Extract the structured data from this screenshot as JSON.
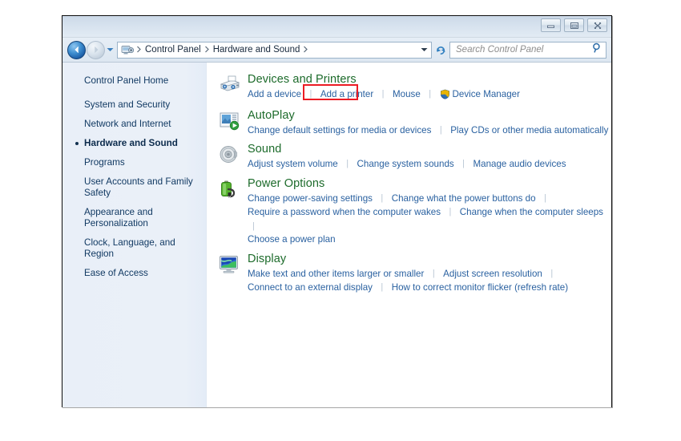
{
  "window": {
    "controls": [
      {
        "name": "minimize-button",
        "glyph": "minimize"
      },
      {
        "name": "restore-button",
        "glyph": "restore"
      },
      {
        "name": "close-button",
        "glyph": "close"
      }
    ]
  },
  "addressbar": {
    "back_label": "Back",
    "forward_label": "Forward",
    "history_label": "Recent pages",
    "crumb_icon": "control-panel-icon",
    "breadcrumbs": [
      "Control Panel",
      "Hardware and Sound"
    ],
    "refresh_label": "Refresh",
    "dropdown_label": "Previous locations"
  },
  "search": {
    "placeholder": "Search Control Panel",
    "icon": "search-icon"
  },
  "sidebar": {
    "home": "Control Panel Home",
    "items": [
      {
        "label": "System and Security",
        "active": false
      },
      {
        "label": "Network and Internet",
        "active": false
      },
      {
        "label": "Hardware and Sound",
        "active": true
      },
      {
        "label": "Programs",
        "active": false
      },
      {
        "label": "User Accounts and Family Safety",
        "active": false
      },
      {
        "label": "Appearance and Personalization",
        "active": false
      },
      {
        "label": "Clock, Language, and Region",
        "active": false
      },
      {
        "label": "Ease of Access",
        "active": false
      }
    ]
  },
  "categories": [
    {
      "title": "Devices and Printers",
      "icon": "devices-and-printers-icon",
      "rows": [
        [
          {
            "label": "Add a device"
          },
          {
            "label": "Add a printer",
            "highlighted": true
          },
          {
            "label": "Mouse"
          },
          {
            "label": "Device Manager",
            "shield": true,
            "no_sep_after_prev": false
          }
        ]
      ]
    },
    {
      "title": "AutoPlay",
      "icon": "autoplay-icon",
      "rows": [
        [
          {
            "label": "Change default settings for media or devices"
          },
          {
            "label": "Play CDs or other media automatically"
          }
        ]
      ]
    },
    {
      "title": "Sound",
      "icon": "sound-icon",
      "rows": [
        [
          {
            "label": "Adjust system volume"
          },
          {
            "label": "Change system sounds"
          },
          {
            "label": "Manage audio devices"
          }
        ]
      ]
    },
    {
      "title": "Power Options",
      "icon": "power-options-icon",
      "rows": [
        [
          {
            "label": "Change power-saving settings"
          },
          {
            "label": "Change what the power buttons do"
          },
          {
            "label": "",
            "trailing_sep": true
          }
        ],
        [
          {
            "label": "Require a password when the computer wakes"
          },
          {
            "label": "Change when the computer sleeps"
          },
          {
            "label": "",
            "trailing_sep": true
          }
        ],
        [
          {
            "label": "Choose a power plan"
          }
        ]
      ]
    },
    {
      "title": "Display",
      "icon": "display-icon",
      "rows": [
        [
          {
            "label": "Make text and other items larger or smaller"
          },
          {
            "label": "Adjust screen resolution"
          },
          {
            "label": "",
            "trailing_sep": true
          }
        ],
        [
          {
            "label": "Connect to an external display"
          },
          {
            "label": "How to correct monitor flicker (refresh rate)"
          }
        ]
      ]
    }
  ],
  "colors": {
    "heading_green": "#1d6b2b",
    "link_blue": "#2a61a0",
    "highlight_red": "#ec1c24",
    "sidebar_blue": "#e9eff8"
  }
}
